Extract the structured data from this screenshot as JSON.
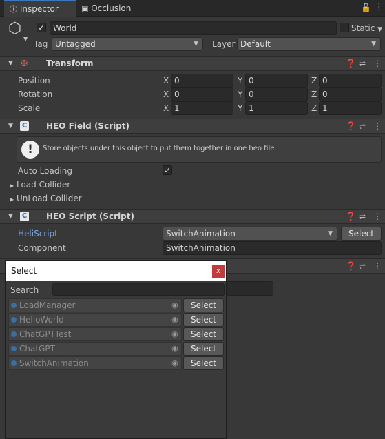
{
  "tabs": [
    {
      "label": "Inspector",
      "icon": "info-icon"
    },
    {
      "label": "Occlusion",
      "icon": "occlusion-icon"
    }
  ],
  "object": {
    "active_checked": true,
    "name": "World",
    "static_label": "Static",
    "tag_label": "Tag",
    "tag_value": "Untagged",
    "layer_label": "Layer",
    "layer_value": "Default"
  },
  "transform": {
    "title": "Transform",
    "rows": [
      {
        "label": "Position",
        "x": "0",
        "y": "0",
        "z": "0"
      },
      {
        "label": "Rotation",
        "x": "0",
        "y": "0",
        "z": "0"
      },
      {
        "label": "Scale",
        "x": "1",
        "y": "1",
        "z": "1"
      }
    ],
    "axes": [
      "X",
      "Y",
      "Z"
    ]
  },
  "heo_field": {
    "title": "HEO Field (Script)",
    "info": "Store objects under this object to put them together in one heo file.",
    "auto_loading_label": "Auto Loading",
    "auto_loading_checked": true,
    "load_collider_label": "Load Collider",
    "unload_collider_label": "UnLoad Collider"
  },
  "heo_script": {
    "title": "HEO Script (Script)",
    "heliscript_label": "HeliScript",
    "heliscript_value": "SwitchAnimation",
    "select_label": "Select",
    "component_label": "Component",
    "component_value": "SwitchAnimation"
  },
  "select_dialog": {
    "title": "Select",
    "close": "x",
    "search_label": "Search",
    "search_value": "",
    "items": [
      {
        "name": "LoadManager",
        "button": "Select"
      },
      {
        "name": "HelloWorld",
        "button": "Select"
      },
      {
        "name": "ChatGPTTest",
        "button": "Select"
      },
      {
        "name": "ChatGPT",
        "button": "Select"
      },
      {
        "name": "SwitchAnimation",
        "button": "Select"
      }
    ]
  },
  "colors": {
    "accent": "#3a79bb",
    "link_label": "#7aa6e0",
    "close_button": "#c23a3a"
  }
}
